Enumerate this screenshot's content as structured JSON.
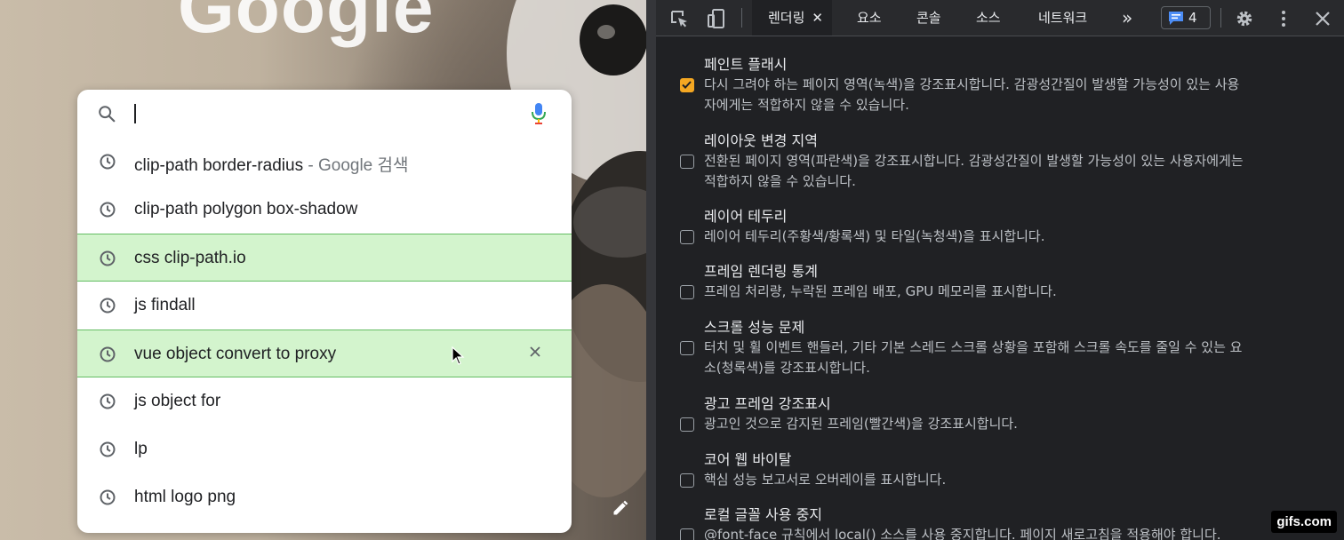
{
  "page": {
    "logo_text": "Google",
    "search": {
      "value": ""
    },
    "suggestions": [
      {
        "text": "clip-path border-radius",
        "suffix": " - Google 검색",
        "highlighted": false
      },
      {
        "text": "clip-path polygon box-shadow",
        "suffix": "",
        "highlighted": false
      },
      {
        "text": "css clip-path.io",
        "suffix": "",
        "highlighted": true
      },
      {
        "text": "js findall",
        "suffix": "",
        "highlighted": false
      },
      {
        "text": "vue object convert to proxy",
        "suffix": "",
        "highlighted": true,
        "hovered": true
      },
      {
        "text": "js object for",
        "suffix": "",
        "highlighted": false
      },
      {
        "text": "lp",
        "suffix": "",
        "highlighted": false
      },
      {
        "text": "html logo png",
        "suffix": "",
        "highlighted": false
      }
    ]
  },
  "devtools": {
    "tabs": [
      {
        "label": "렌더링",
        "active": true
      },
      {
        "label": "요소",
        "active": false
      },
      {
        "label": "콘솔",
        "active": false
      },
      {
        "label": "소스",
        "active": false
      },
      {
        "label": "네트워크",
        "active": false
      }
    ],
    "more_tabs_glyph": "»",
    "issues_count": "4",
    "rendering_options": [
      {
        "title": "페인트 플래시",
        "checked": true,
        "lines": [
          "다시 그려야 하는 페이지 영역(녹색)을 강조표시합니다. 감광성간질이 발생할 가능성이 있는 사용",
          "자에게는 적합하지 않을 수 있습니다."
        ]
      },
      {
        "title": "레이아웃 변경 지역",
        "checked": false,
        "lines": [
          "전환된 페이지 영역(파란색)을 강조표시합니다. 감광성간질이 발생할 가능성이 있는 사용자에게는",
          "적합하지 않을 수 있습니다."
        ]
      },
      {
        "title": "레이어 테두리",
        "checked": false,
        "lines": [
          "레이어 테두리(주황색/황록색) 및 타일(녹청색)을 표시합니다."
        ]
      },
      {
        "title": "프레임 렌더링 통계",
        "checked": false,
        "lines": [
          "프레임 처리량, 누락된 프레임 배포, GPU 메모리를 표시합니다."
        ]
      },
      {
        "title": "스크롤 성능 문제",
        "checked": false,
        "lines": [
          "터치 및 휠 이벤트 핸들러, 기타 기본 스레드 스크롤 상황을 포함해 스크롤 속도를 줄일 수 있는 요",
          "소(청록색)를 강조표시합니다."
        ]
      },
      {
        "title": "광고 프레임 강조표시",
        "checked": false,
        "lines": [
          "광고인 것으로 감지된 프레임(빨간색)을 강조표시합니다."
        ]
      },
      {
        "title": "코어 웹 바이탈",
        "checked": false,
        "lines": [
          "핵심 성능 보고서로 오버레이를 표시합니다."
        ]
      },
      {
        "title": "로컬 글꼴 사용 중지",
        "checked": false,
        "lines": [
          "@font-face 규칙에서 local() 소스를 사용 중지합니다. 페이지 새로고침을 적용해야 합니다."
        ]
      }
    ]
  },
  "watermark": "gifs.com",
  "colors": {
    "highlight_fill": "#d3f4cd",
    "highlight_border": "#64bd63",
    "checkbox_checked": "#f4a722",
    "devtools_bg": "#202124",
    "issues_icon": "#4c8df6"
  }
}
